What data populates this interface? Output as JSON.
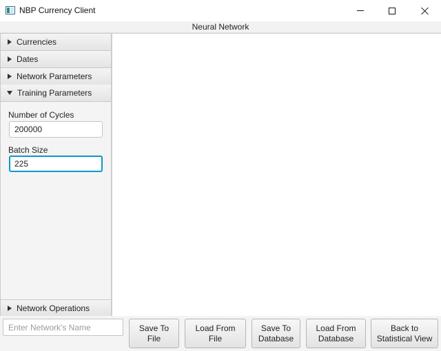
{
  "window": {
    "title": "NBP Currency Client"
  },
  "panel": {
    "title": "Neural Network"
  },
  "sidebar": {
    "sections": [
      {
        "label": "Currencies",
        "expanded": false
      },
      {
        "label": "Dates",
        "expanded": false
      },
      {
        "label": "Network Parameters",
        "expanded": false
      },
      {
        "label": "Training Parameters",
        "expanded": true
      },
      {
        "label": "Network Operations",
        "expanded": false
      }
    ],
    "training": {
      "cycles_label": "Number of Cycles",
      "cycles_value": "200000",
      "batch_label": "Batch Size",
      "batch_value": "225"
    }
  },
  "bottom": {
    "name_placeholder": "Enter Network's Name",
    "buttons": {
      "save_file": "Save To\nFile",
      "load_file": "Load From File",
      "save_db": "Save To\nDatabase",
      "load_db": "Load From\nDatabase",
      "back": "Back to\nStatistical View"
    }
  },
  "colors": {
    "focus_accent": "#0a98c8"
  }
}
